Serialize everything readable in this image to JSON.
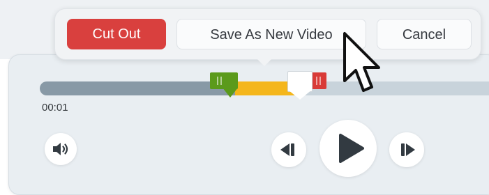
{
  "popover": {
    "cut_out_label": "Cut Out",
    "save_as_new_label": "Save As New Video",
    "cancel_label": "Cancel"
  },
  "timeline": {
    "current_time": "00:01",
    "selection_start_fraction": 0.42,
    "selection_end_fraction": 0.55,
    "playhead_fraction": 0.52
  },
  "controls": {
    "volume_icon": "speaker-volume-icon",
    "previous_icon": "step-back-icon",
    "play_icon": "play-icon",
    "next_icon": "step-forward-icon"
  },
  "colors": {
    "cut_out": "#d9403e",
    "selection": "#f4b61c",
    "in_handle": "#5b9a1b",
    "out_handle": "#d93a37",
    "played_track": "#8899a6",
    "remaining_track": "#c8d3db"
  }
}
